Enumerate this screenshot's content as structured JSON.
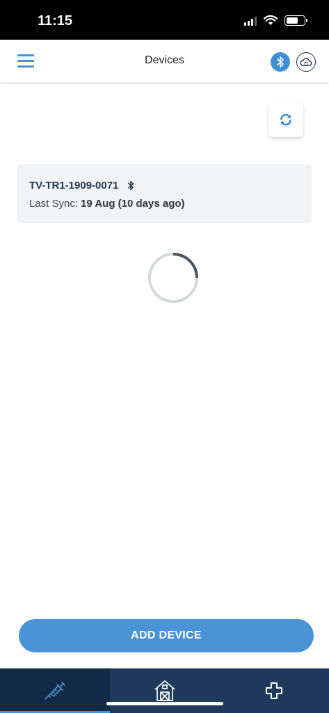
{
  "status_bar": {
    "time": "11:15"
  },
  "header": {
    "title": "Devices"
  },
  "device_card": {
    "device_name": "TV-TR1-1909-0071",
    "sync_label": "Last Sync:",
    "sync_value": "19 Aug (10 days ago)"
  },
  "actions": {
    "add_device_label": "ADD DEVICE"
  },
  "icons": {
    "menu": "hamburger-menu-icon",
    "bluetooth": "bluetooth-icon",
    "cloud": "cloud-sync-icon",
    "refresh": "refresh-icon",
    "loading": "spinner-icon",
    "tab1": "syringe-icon",
    "tab2": "barn-icon",
    "tab3": "medical-cross-icon"
  },
  "colors": {
    "accent": "#4a93d4",
    "navy": "#1f3a5c",
    "active_tab": "#132a47"
  }
}
